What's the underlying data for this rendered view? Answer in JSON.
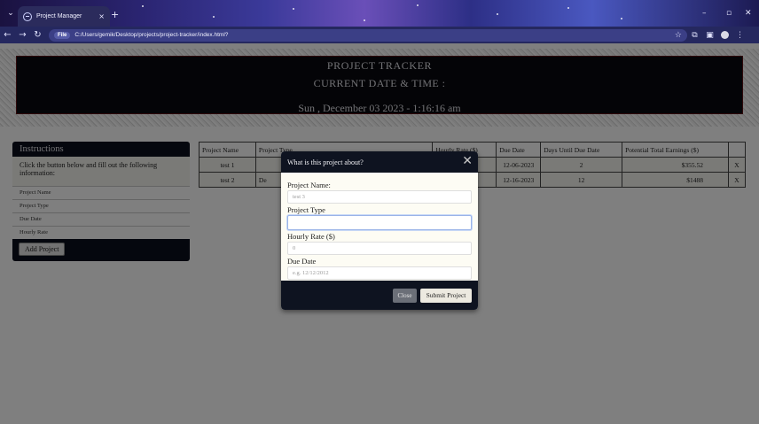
{
  "browser": {
    "tab_title": "Project Manager",
    "tab_close": "×",
    "new_tab": "+",
    "url_chip": "File",
    "url": "C:/Users/gemik/Desktop/projects/project-tracker/index.html?",
    "controls": {
      "minimize": "–",
      "maximize": "▫",
      "close": "✕"
    },
    "nav": {
      "back": "←",
      "forward": "→",
      "reload": "↻"
    }
  },
  "header": {
    "title": "PROJECT TRACKER",
    "subtitle": "CURRENT DATE & TIME :",
    "datetime": "Sun , December 03 2023 - 1:16:16 am"
  },
  "sidebar": {
    "title": "Instructions",
    "instructions": "Click the button below and fill out the following information:",
    "fields": [
      "Project Name",
      "Project Type",
      "Due Date",
      "Hourly Rate"
    ],
    "add_button": "Add Project"
  },
  "table": {
    "headers": [
      "Project Name",
      "Project Type",
      "Hourly Rate ($)",
      "Due Date",
      "Days Until Due Date",
      "Potential Total Earnings ($)",
      ""
    ],
    "rows": [
      [
        "test 1",
        "",
        "",
        "12-06-2023",
        "2",
        "$355.52",
        "X"
      ],
      [
        "test 2",
        "De",
        "",
        "12-16-2023",
        "12",
        "$1488",
        "X"
      ]
    ]
  },
  "modal": {
    "title": "What is this project about?",
    "close_icon": "✕",
    "fields": [
      {
        "label": "Project Name:",
        "placeholder": "test 3"
      },
      {
        "label": "Project Type",
        "placeholder": ""
      },
      {
        "label": "Hourly Rate ($)",
        "placeholder": "0"
      },
      {
        "label": "Due Date",
        "placeholder": "e.g. 12/12/2012"
      }
    ],
    "close_button": "Close",
    "submit_button": "Submit Project"
  },
  "colors": {
    "header_bg": "#08090f",
    "modal_header_bg": "#0e1320",
    "overlay": "rgba(0,0,0,0.5)",
    "focus_ring": "#9ab4e8"
  }
}
